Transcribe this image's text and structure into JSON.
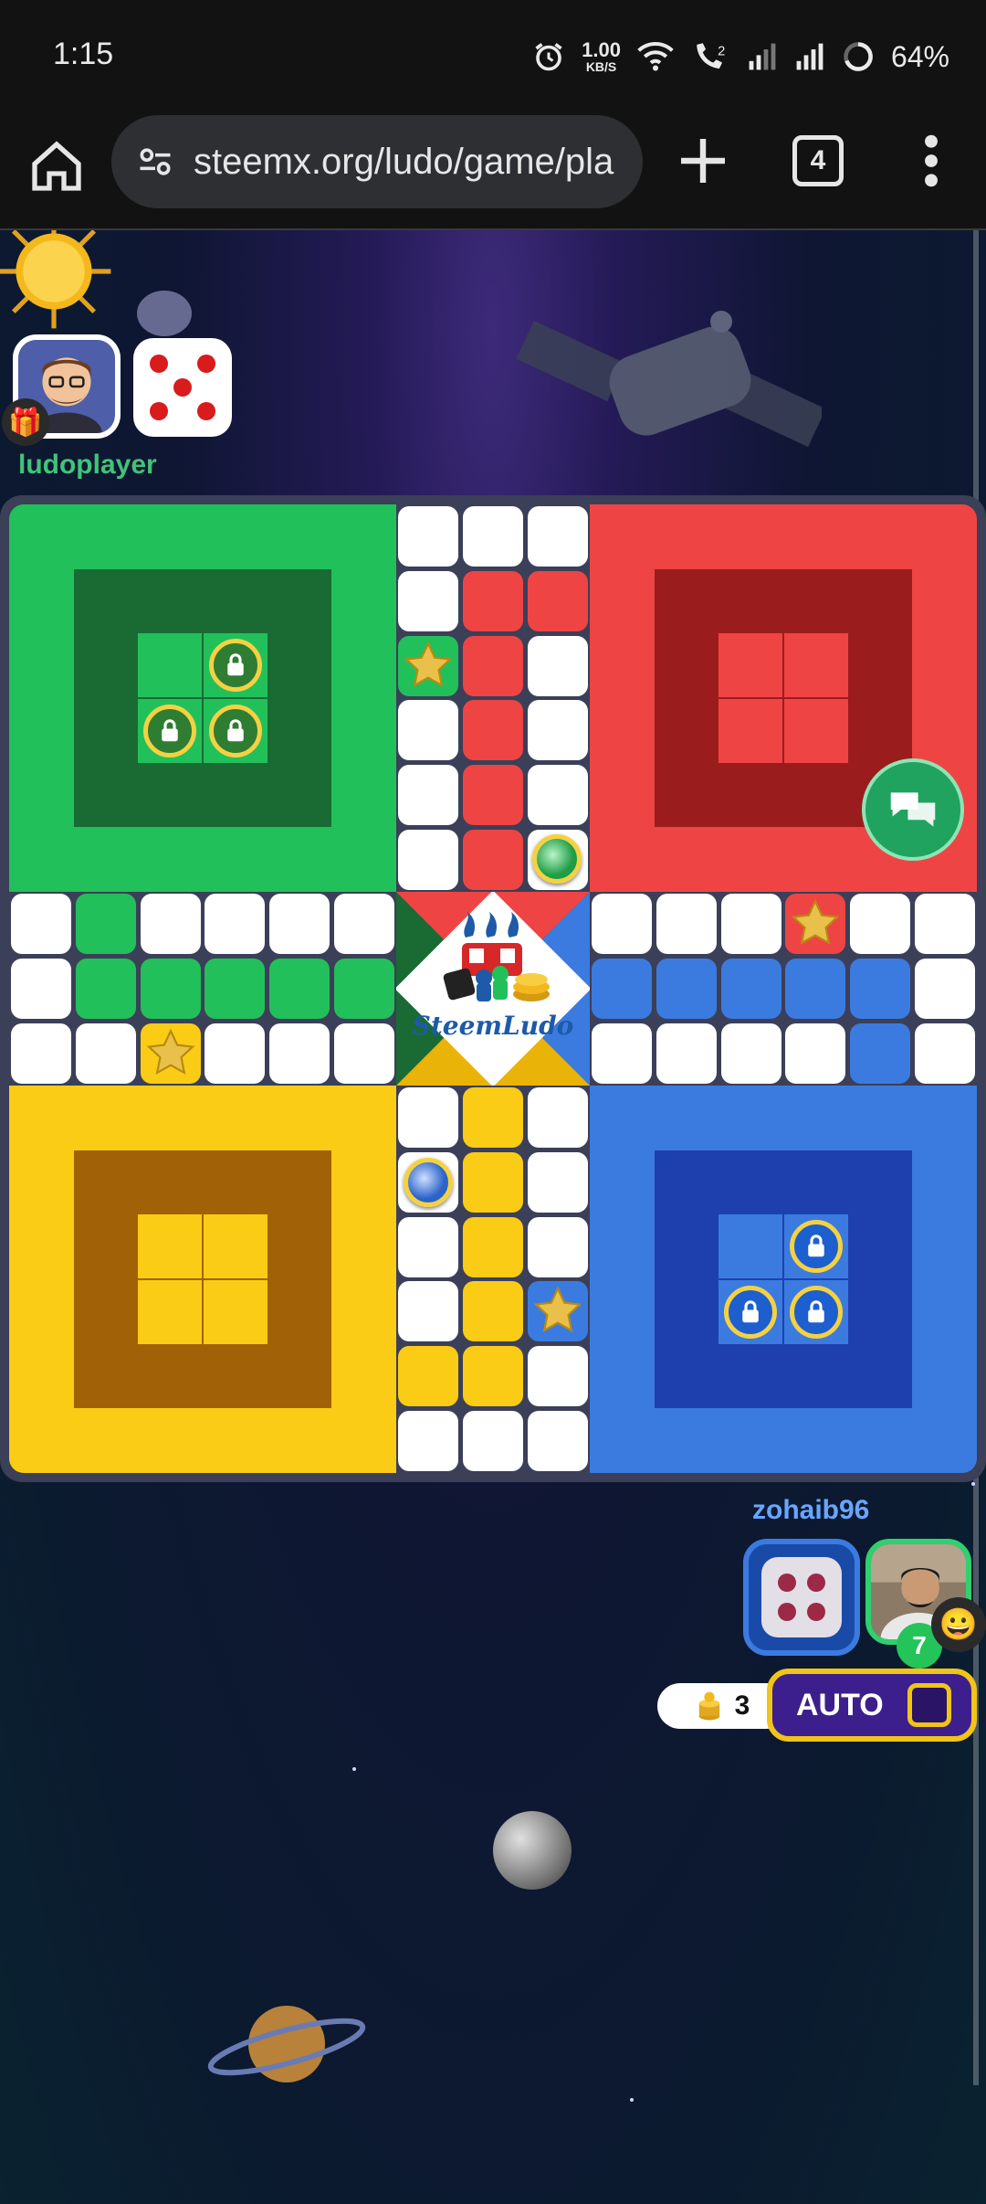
{
  "status_bar": {
    "time": "1:15",
    "net_speed_value": "1.00",
    "net_speed_unit": "KB/S",
    "sim_indicator": "2",
    "battery": "64%",
    "icons": [
      "alarm-icon",
      "wifi-icon",
      "wifi-call-icon",
      "signal-icon",
      "signal-icon",
      "battery-icon"
    ]
  },
  "browser": {
    "url": "steemx.org/ludo/game/pla",
    "tab_count": "4",
    "icons": [
      "home-icon",
      "site-settings-icon",
      "plus-icon",
      "tabs-icon",
      "more-vert-icon"
    ]
  },
  "players": {
    "top": {
      "name": "ludoplayer",
      "dice_value": 5,
      "color": "#22c05a"
    },
    "bottom": {
      "name": "zohaib96",
      "dice_value": 4,
      "token_count": "7",
      "color": "#3b7be0"
    }
  },
  "board": {
    "colors": {
      "green": "#22c05a",
      "green_dark": "#196b33",
      "red": "#ef4444",
      "red_dark": "#9b1c1c",
      "yellow": "#facc15",
      "yellow_dark": "#a16207",
      "blue": "#3b7be0",
      "blue_dark": "#1e40af"
    },
    "logo_text": "SteemLudo"
  },
  "controls": {
    "coin_count": "3",
    "auto_label": "AUTO",
    "chat_icon": "chat-icon"
  }
}
